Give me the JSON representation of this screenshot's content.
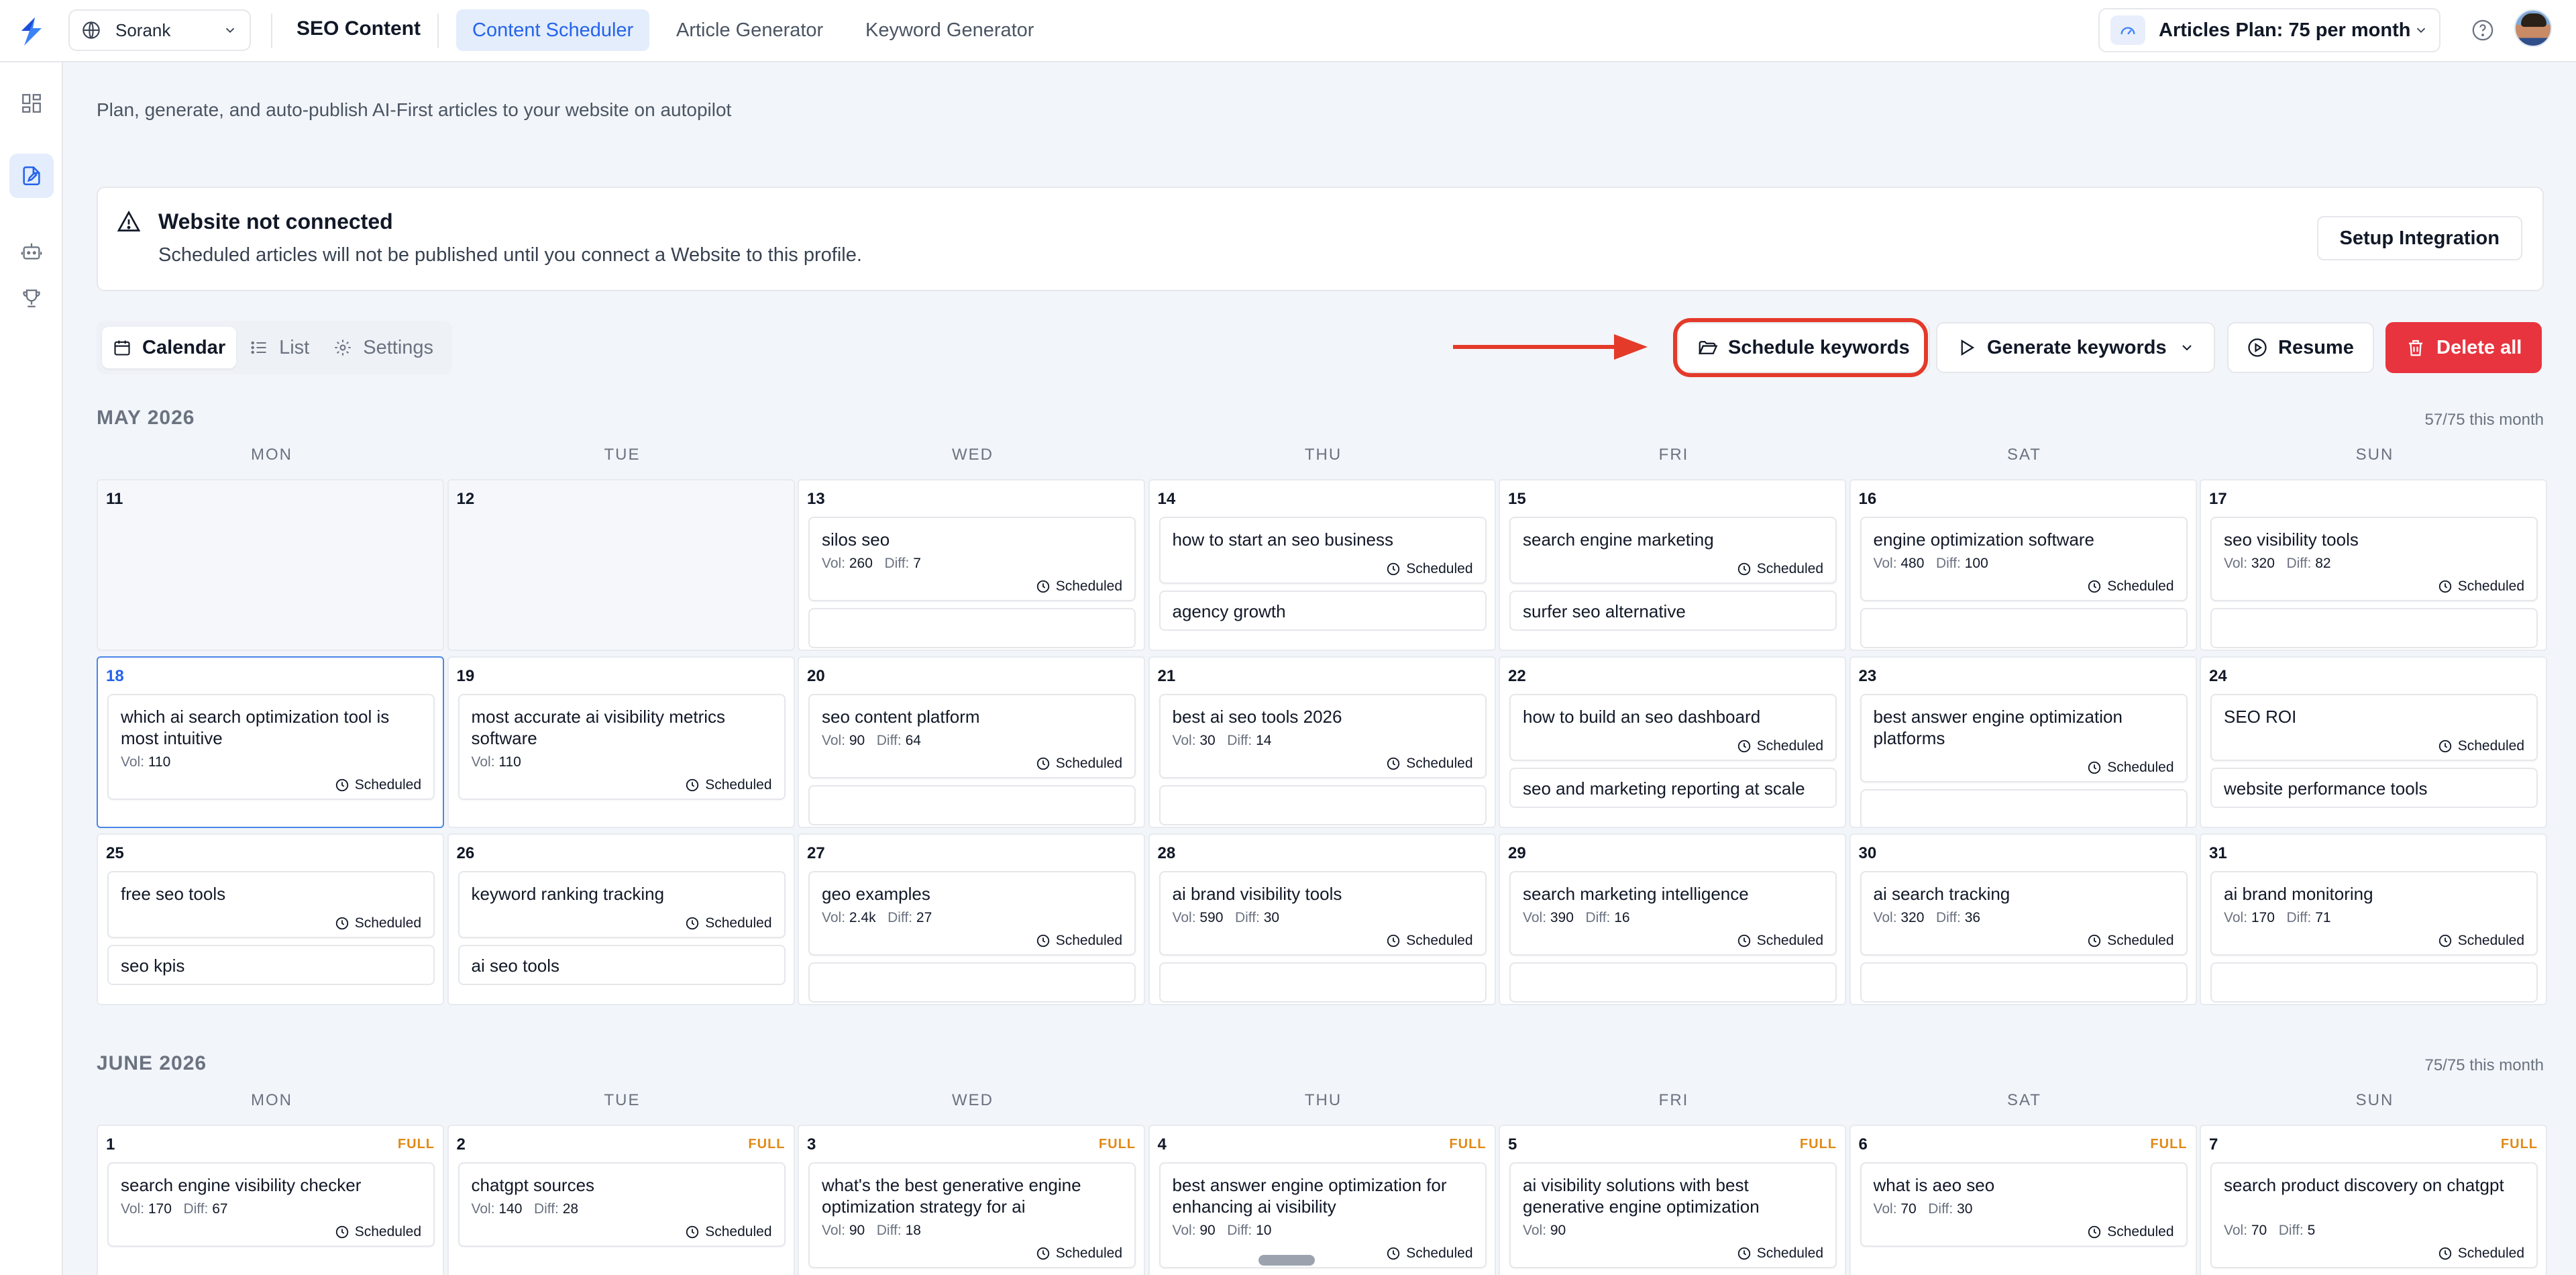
{
  "header": {
    "workspace": "Sorank",
    "brand": "SEO Content",
    "tabs": [
      "Content Scheduler",
      "Article Generator",
      "Keyword Generator"
    ],
    "plan": "Articles Plan: 75 per month"
  },
  "subtitle": "Plan, generate, and auto-publish AI-First articles to your website on autopilot",
  "alert": {
    "title": "Website not connected",
    "message": "Scheduled articles will not be published until you connect a Website to this profile.",
    "button": "Setup Integration"
  },
  "view_tabs": [
    "Calendar",
    "List",
    "Settings"
  ],
  "actions": {
    "schedule": "Schedule keywords",
    "generate": "Generate keywords",
    "resume": "Resume",
    "delete": "Delete all"
  },
  "labels": {
    "vol": "Vol:",
    "diff": "Diff:",
    "scheduled": "Scheduled",
    "full": "FULL"
  },
  "weekdays": [
    "MON",
    "TUE",
    "WED",
    "THU",
    "FRI",
    "SAT",
    "SUN"
  ],
  "may": {
    "title": "MAY 2026",
    "count": "57/75 this month",
    "weeks": [
      [
        {
          "day": "11",
          "off": true
        },
        {
          "day": "12",
          "off": true
        },
        {
          "day": "13",
          "title": "silos seo",
          "vol": "260",
          "diff": "7",
          "peek": ""
        },
        {
          "day": "14",
          "title": "how to start an seo business",
          "peek": "agency growth"
        },
        {
          "day": "15",
          "title": "search engine marketing",
          "peek": "surfer seo alternative"
        },
        {
          "day": "16",
          "title": "engine optimization software",
          "vol": "480",
          "diff": "100",
          "peek": ""
        },
        {
          "day": "17",
          "title": "seo visibility tools",
          "vol": "320",
          "diff": "82",
          "peek": ""
        }
      ],
      [
        {
          "day": "18",
          "today": true,
          "title": "which ai search optimization tool is most intuitive",
          "vol": "110"
        },
        {
          "day": "19",
          "title": "most accurate ai visibility metrics software",
          "vol": "110"
        },
        {
          "day": "20",
          "title": "seo content platform",
          "vol": "90",
          "diff": "64",
          "peek": ""
        },
        {
          "day": "21",
          "title": "best ai seo tools 2026",
          "vol": "30",
          "diff": "14",
          "peek": ""
        },
        {
          "day": "22",
          "title": "how to build an seo dashboard",
          "peek": "seo and marketing reporting at scale"
        },
        {
          "day": "23",
          "title": "best answer engine optimization platforms",
          "peek": ""
        },
        {
          "day": "24",
          "title": "SEO ROI",
          "peek": "website performance tools"
        }
      ],
      [
        {
          "day": "25",
          "title": "free seo tools",
          "peek": "seo kpis"
        },
        {
          "day": "26",
          "title": "keyword ranking tracking",
          "peek": "ai seo tools"
        },
        {
          "day": "27",
          "title": "geo examples",
          "vol": "2.4k",
          "diff": "27",
          "peek": ""
        },
        {
          "day": "28",
          "title": "ai brand visibility tools",
          "vol": "590",
          "diff": "30",
          "peek": ""
        },
        {
          "day": "29",
          "title": "search marketing intelligence",
          "vol": "390",
          "diff": "16",
          "peek": ""
        },
        {
          "day": "30",
          "title": "ai search tracking",
          "vol": "320",
          "diff": "36",
          "peek": ""
        },
        {
          "day": "31",
          "title": "ai brand monitoring",
          "vol": "170",
          "diff": "71",
          "peek": ""
        }
      ]
    ]
  },
  "june": {
    "title": "JUNE 2026",
    "count": "75/75 this month",
    "weeks": [
      [
        {
          "day": "1",
          "full": true,
          "title": "search engine visibility checker",
          "vol": "170",
          "diff": "67"
        },
        {
          "day": "2",
          "full": true,
          "title": "chatgpt sources",
          "vol": "140",
          "diff": "28"
        },
        {
          "day": "3",
          "full": true,
          "title": "what's the best generative engine optimization strategy for ai",
          "vol": "90",
          "diff": "18"
        },
        {
          "day": "4",
          "full": true,
          "title": "best answer engine optimization for enhancing ai visibility",
          "vol": "90",
          "diff": "10"
        },
        {
          "day": "5",
          "full": true,
          "title": "ai visibility solutions with best generative engine optimization",
          "vol": "90"
        },
        {
          "day": "6",
          "full": true,
          "title": "what is aeo seo",
          "vol": "70",
          "diff": "30"
        },
        {
          "day": "7",
          "full": true,
          "title": "search product discovery on chatgpt",
          "vol": "70",
          "diff": "5"
        }
      ]
    ]
  }
}
